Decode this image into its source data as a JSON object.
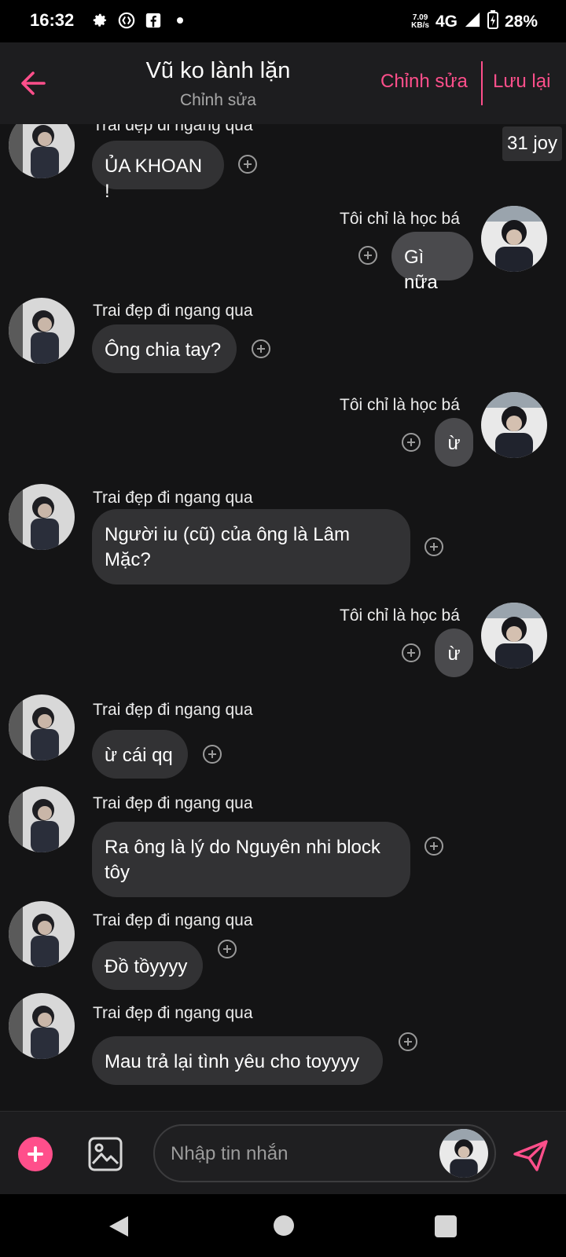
{
  "status_bar": {
    "time": "16:32",
    "net_speed_value": "7.09",
    "net_speed_unit": "KB/s",
    "network": "4G",
    "battery": "28%",
    "icons": [
      "settings-icon",
      "shazam-icon",
      "facebook-icon",
      "dot-icon",
      "signal-icon",
      "battery-charging-icon"
    ]
  },
  "header": {
    "title": "Vũ ko lành lặn",
    "subtitle": "Chỉnh sửa",
    "edit_label": "Chỉnh sửa",
    "save_label": "Lưu lại",
    "accent_color": "#ff4f8b"
  },
  "chat": {
    "badge": "31 joy",
    "messages": [
      {
        "side": "left",
        "sender": "Trai đẹp đi ngang qua",
        "text": "ỦA KHOAN !"
      },
      {
        "side": "right",
        "sender": "Tôi chỉ là học bá",
        "text": "Gì nữa"
      },
      {
        "side": "left",
        "sender": "Trai đẹp đi ngang qua",
        "text": "Ông chia tay?"
      },
      {
        "side": "right",
        "sender": "Tôi chỉ là học bá",
        "text": "ừ"
      },
      {
        "side": "left",
        "sender": "Trai đẹp đi ngang qua",
        "text": "Người iu (cũ) của ông là Lâm Mặc?"
      },
      {
        "side": "right",
        "sender": "Tôi chỉ là học bá",
        "text": "ừ"
      },
      {
        "side": "left",
        "sender": "Trai đẹp đi ngang qua",
        "text": "ừ cái qq"
      },
      {
        "side": "left",
        "sender": "Trai đẹp đi ngang qua",
        "text": "Ra ông là lý do Nguyên nhi block tôy"
      },
      {
        "side": "left",
        "sender": "Trai đẹp đi ngang qua",
        "text": "Đồ tồyyyy"
      },
      {
        "side": "left",
        "sender": "Trai đẹp đi ngang qua",
        "text": "Mau trả lại tình yêu cho toyyyy"
      }
    ]
  },
  "input_bar": {
    "placeholder": "Nhập tin nhắn",
    "icons": [
      "add-icon",
      "image-icon",
      "avatar-selector",
      "send-icon"
    ]
  },
  "nav_bar": {
    "icons": [
      "back-triangle-icon",
      "home-circle-icon",
      "recents-square-icon"
    ]
  }
}
